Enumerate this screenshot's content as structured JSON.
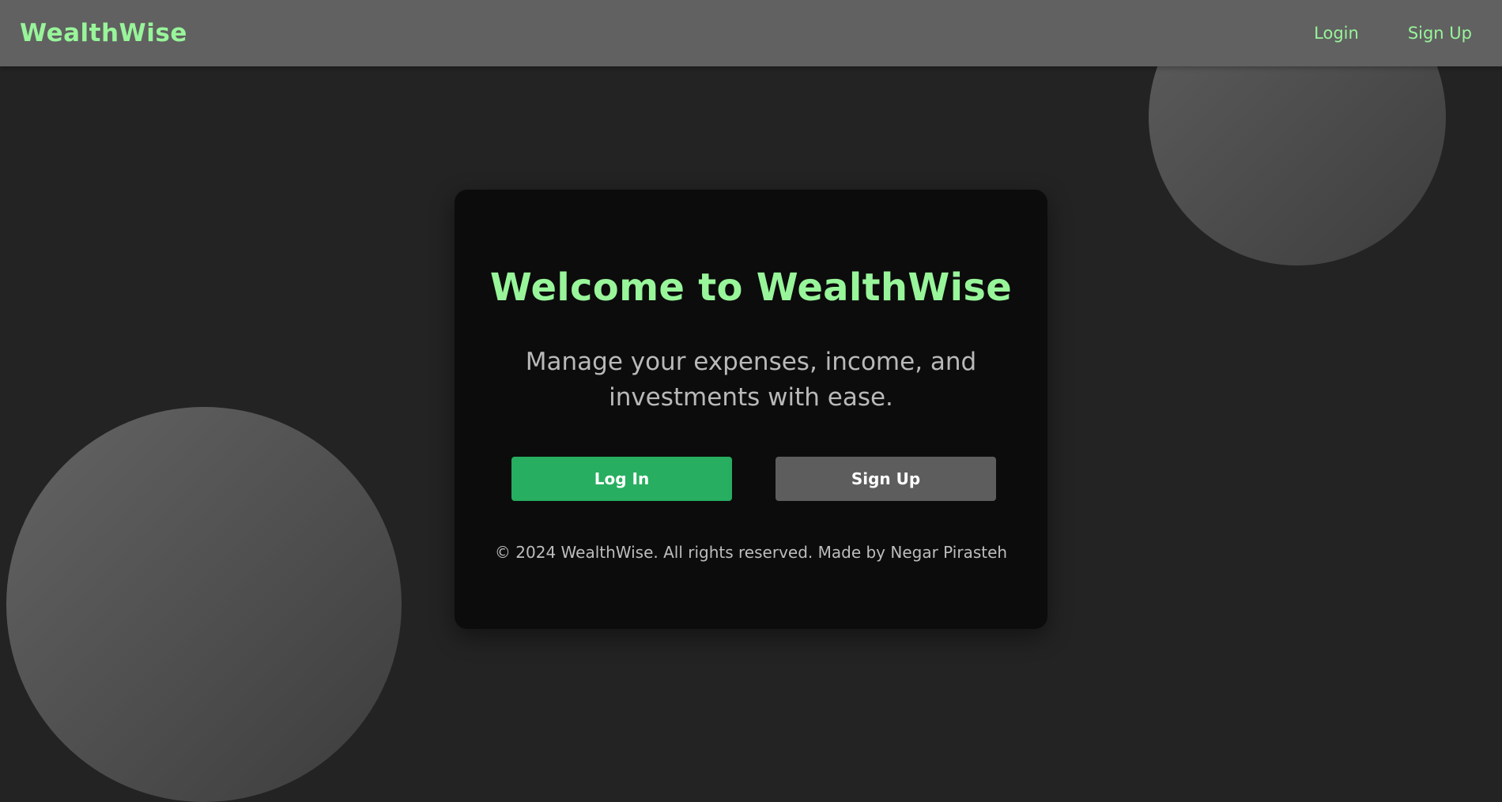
{
  "nav": {
    "brand": "WealthWise",
    "links": [
      "Login",
      "Sign Up"
    ]
  },
  "card": {
    "title": "Welcome to WealthWise",
    "subtitle": "Manage your expenses, income, and investments with ease.",
    "login_label": "Log In",
    "signup_label": "Sign Up",
    "footer": "© 2024 WealthWise. All rights reserved. Made by Negar Pirasteh"
  },
  "colors": {
    "accent_green": "#98f59a",
    "login_button": "#27ae60",
    "signup_button": "#5d5d5d",
    "navbar": "#616161",
    "background": "#232323",
    "card": "#0c0c0c"
  }
}
